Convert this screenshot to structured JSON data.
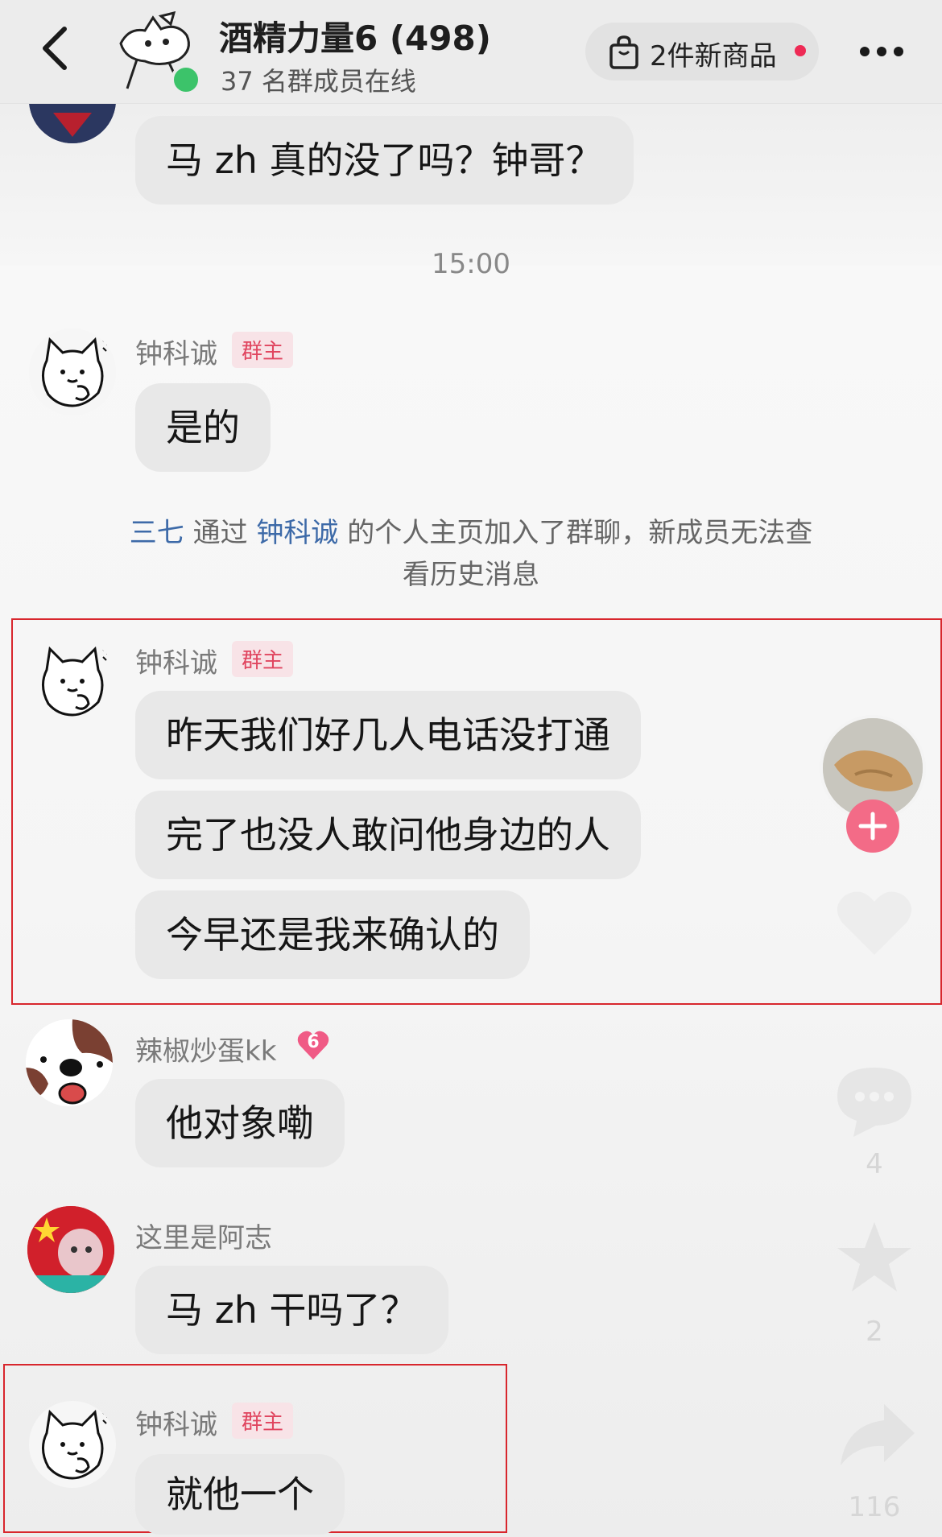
{
  "header": {
    "group_title": "酒精力量6 (498)",
    "online_text": "37 名群成员在线",
    "goods_text": "2件新商品"
  },
  "messages": {
    "top_bubble": "马 zh 真的没了吗？钟哥？",
    "time": "15:00",
    "msg1": {
      "sender": "钟科诚",
      "badge": "群主",
      "text": "是的"
    },
    "system": {
      "name1": "三七",
      "t1": " 通过 ",
      "name2": "钟科诚",
      "t2": " 的个人主页加入了群聊，新成员无法查看历史消息"
    },
    "msg2": {
      "sender": "钟科诚",
      "badge": "群主",
      "lines": [
        "昨天我们好几人电话没打通",
        "完了也没人敢问他身边的人",
        "今早还是我来确认的"
      ]
    },
    "msg3": {
      "sender": "辣椒炒蛋kk",
      "level": "6",
      "text": "他对象嘞"
    },
    "msg4": {
      "sender": "这里是阿志",
      "text": "马 zh 干吗了？"
    },
    "msg5": {
      "sender": "钟科诚",
      "badge": "群主",
      "text": "就他一个"
    }
  },
  "side": {
    "comment_count": "4",
    "favorite_count": "2",
    "share_count": "116"
  },
  "colors": {
    "accent_red": "#d8262d",
    "owner_badge": "#e0455f",
    "online_green": "#3cc36a",
    "link_blue": "#3d6aa8"
  }
}
